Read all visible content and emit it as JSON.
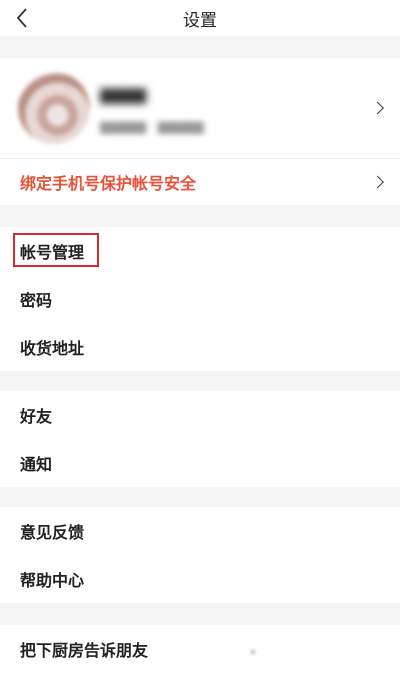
{
  "header": {
    "title": "设置",
    "back_icon": "chevron-left-icon"
  },
  "profile": {
    "name": "▇▇▇▇",
    "subtitle": "▇▇▇▇▇ · ▇▇▇▇▇"
  },
  "bind_phone": {
    "label": "绑定手机号保护帐号安全",
    "color": "#e8523b"
  },
  "groups": [
    {
      "items": [
        {
          "label": "帐号管理",
          "highlighted": true
        },
        {
          "label": "密码"
        },
        {
          "label": "收货地址"
        }
      ]
    },
    {
      "items": [
        {
          "label": "好友"
        },
        {
          "label": "通知"
        }
      ]
    },
    {
      "items": [
        {
          "label": "意见反馈"
        },
        {
          "label": "帮助中心"
        }
      ]
    },
    {
      "items": [
        {
          "label": "把下厨房告诉朋友"
        }
      ]
    }
  ],
  "colors": {
    "background": "#f5f5f5",
    "highlight_border": "#d62b2b"
  }
}
